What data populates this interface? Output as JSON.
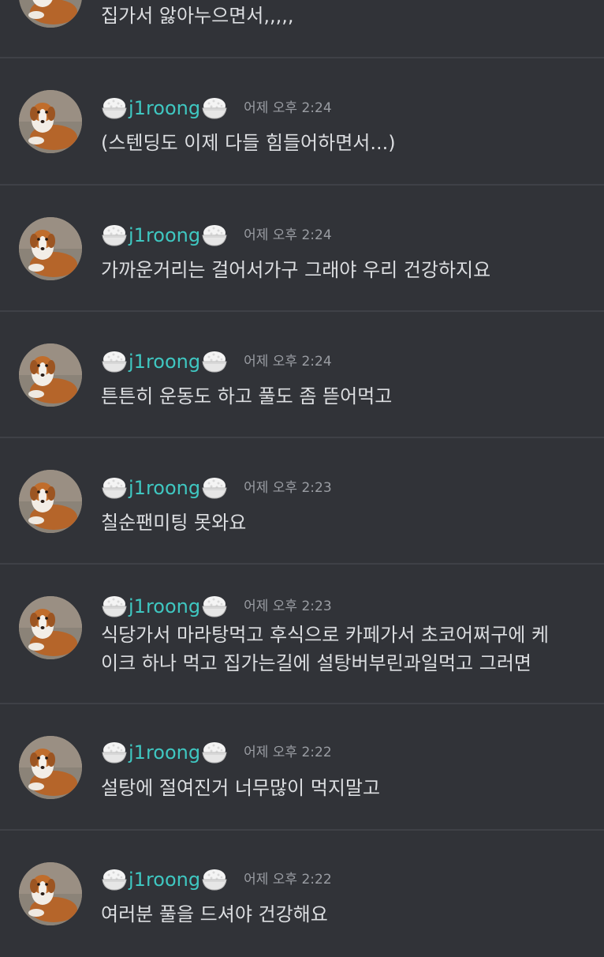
{
  "messages": [
    {
      "username": "",
      "time": "",
      "text": "집가서 앓아누으면서,,,,,",
      "partial": true
    },
    {
      "username": "j1roong",
      "time": "어제 오후 2:24",
      "text": "(스텐딩도 이제 다들 힘들어하면서...)"
    },
    {
      "username": "j1roong",
      "time": "어제 오후 2:24",
      "text": "가까운거리는 걸어서가구 그래야 우리 건강하지요"
    },
    {
      "username": "j1roong",
      "time": "어제 오후 2:24",
      "text": "튼튼히 운동도 하고 풀도 좀 뜯어먹고"
    },
    {
      "username": "j1roong",
      "time": "어제 오후 2:23",
      "text": "칠순팬미팅 못와요"
    },
    {
      "username": "j1roong",
      "time": "어제 오후 2:23",
      "text": "식당가서 마라탕먹고 후식으로 카페가서 초코어쩌구에 케\n이크 하나 먹고 집가는길에 설탕버부린과일먹고 그러면"
    },
    {
      "username": "j1roong",
      "time": "어제 오후 2:22",
      "text": "설탕에 절여진거 너무많이 먹지말고"
    },
    {
      "username": "j1roong",
      "time": "어제 오후 2:22",
      "text": "여러분 풀을 드셔야 건강해요"
    }
  ],
  "icons": {
    "rice": "rice-bowl-emoji",
    "avatar": "dog-avatar"
  },
  "colors": {
    "background": "#313338",
    "divider": "#3f4147",
    "username": "#3fc7c1",
    "timestamp": "#9a9da3",
    "message_text": "#dcdee1"
  }
}
